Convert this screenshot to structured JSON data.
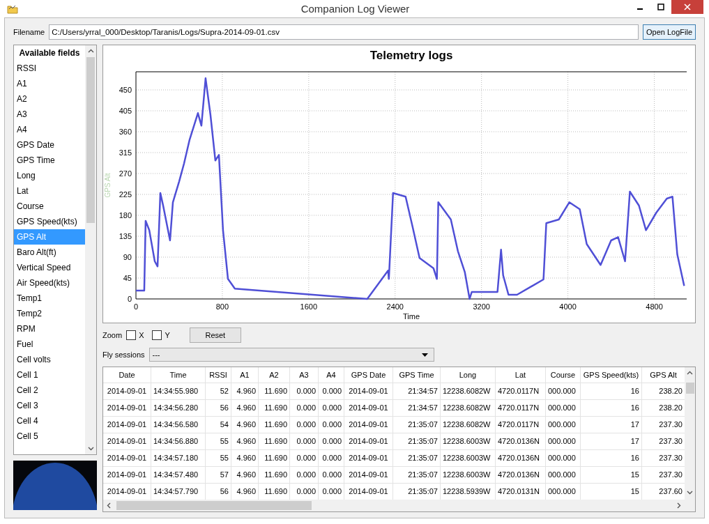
{
  "window": {
    "title": "Companion Log Viewer"
  },
  "file": {
    "label": "Filename",
    "value": "C:/Users/yrral_000/Desktop/Taranis/Logs/Supra-2014-09-01.csv",
    "button": "Open LogFile"
  },
  "fields": {
    "header": "Available fields",
    "items": [
      {
        "label": "RSSI",
        "selected": false
      },
      {
        "label": "A1",
        "selected": false
      },
      {
        "label": "A2",
        "selected": false
      },
      {
        "label": "A3",
        "selected": false
      },
      {
        "label": "A4",
        "selected": false
      },
      {
        "label": "GPS Date",
        "selected": false
      },
      {
        "label": "GPS Time",
        "selected": false
      },
      {
        "label": "Long",
        "selected": false
      },
      {
        "label": "Lat",
        "selected": false
      },
      {
        "label": "Course",
        "selected": false
      },
      {
        "label": "GPS Speed(kts)",
        "selected": false
      },
      {
        "label": "GPS Alt",
        "selected": true
      },
      {
        "label": "Baro Alt(ft)",
        "selected": false
      },
      {
        "label": "Vertical Speed",
        "selected": false
      },
      {
        "label": "Air Speed(kts)",
        "selected": false
      },
      {
        "label": "Temp1",
        "selected": false
      },
      {
        "label": "Temp2",
        "selected": false
      },
      {
        "label": "RPM",
        "selected": false
      },
      {
        "label": "Fuel",
        "selected": false
      },
      {
        "label": "Cell volts",
        "selected": false
      },
      {
        "label": "Cell 1",
        "selected": false
      },
      {
        "label": "Cell 2",
        "selected": false
      },
      {
        "label": "Cell 3",
        "selected": false
      },
      {
        "label": "Cell 4",
        "selected": false
      },
      {
        "label": "Cell 5",
        "selected": false
      }
    ]
  },
  "chart": {
    "chart_data": {
      "type": "line",
      "title": "Telemetry logs",
      "xlabel": "Time",
      "ylabel": "GPS Alt",
      "x": [
        0,
        77,
        90,
        123,
        174,
        200,
        213,
        226,
        252,
        316,
        342,
        400,
        445,
        497,
        574,
        606,
        645,
        690,
        735,
        768,
        806,
        852,
        916,
        2142,
        2335,
        2342,
        2381,
        2497,
        2561,
        2626,
        2755,
        2787,
        2800,
        2916,
        2981,
        3045,
        3090,
        3110,
        3348,
        3381,
        3400,
        3450,
        3529,
        3774,
        3800,
        3916,
        4013,
        4110,
        4174,
        4303,
        4400,
        4465,
        4529,
        4574,
        4658,
        4723,
        4819,
        4916,
        4968,
        5013,
        5077
      ],
      "series": [
        {
          "color": "#4f4fd6",
          "values": [
            18,
            18,
            168,
            148,
            81,
            70,
            148,
            228,
            201,
            126,
            208,
            253,
            291,
            343,
            400,
            373,
            475,
            396,
            298,
            310,
            148,
            43,
            22,
            0,
            61,
            43,
            228,
            220,
            156,
            88,
            66,
            43,
            208,
            171,
            103,
            58,
            0,
            15,
            15,
            106,
            51,
            9,
            9,
            42,
            163,
            171,
            208,
            193,
            118,
            73,
            126,
            133,
            81,
            231,
            201,
            148,
            186,
            216,
            220,
            96,
            28
          ]
        }
      ],
      "grid": true,
      "xlim": [
        0,
        5100
      ],
      "ylim": [
        0,
        489
      ],
      "xticks": [
        0,
        800,
        1600,
        2400,
        3200,
        4000,
        4800
      ],
      "yticks": [
        0,
        45,
        90,
        135,
        180,
        225,
        270,
        315,
        360,
        405,
        450
      ]
    }
  },
  "zoom": {
    "label": "Zoom",
    "options": [
      {
        "label": "X",
        "checked": false
      },
      {
        "label": "Y",
        "checked": false
      }
    ],
    "reset": "Reset"
  },
  "sessions": {
    "label": "Fly sessions",
    "value": "---"
  },
  "table": {
    "columns": [
      "Date",
      "Time",
      "RSSI",
      "A1",
      "A2",
      "A3",
      "A4",
      "GPS Date",
      "GPS Time",
      "Long",
      "Lat",
      "Course",
      "GPS Speed(kts)",
      "GPS Alt"
    ],
    "rows": [
      [
        "2014-09-01",
        "14:34:55.980",
        "52",
        "4.960",
        "11.690",
        "0.000",
        "0.000",
        "2014-09-01",
        "21:34:57",
        "12238.6082W",
        "4720.0117N",
        "000.000",
        "16",
        "238.20"
      ],
      [
        "2014-09-01",
        "14:34:56.280",
        "56",
        "4.960",
        "11.690",
        "0.000",
        "0.000",
        "2014-09-01",
        "21:34:57",
        "12238.6082W",
        "4720.0117N",
        "000.000",
        "16",
        "238.20"
      ],
      [
        "2014-09-01",
        "14:34:56.580",
        "54",
        "4.960",
        "11.690",
        "0.000",
        "0.000",
        "2014-09-01",
        "21:35:07",
        "12238.6082W",
        "4720.0117N",
        "000.000",
        "17",
        "237.30"
      ],
      [
        "2014-09-01",
        "14:34:56.880",
        "55",
        "4.960",
        "11.690",
        "0.000",
        "0.000",
        "2014-09-01",
        "21:35:07",
        "12238.6003W",
        "4720.0136N",
        "000.000",
        "17",
        "237.30"
      ],
      [
        "2014-09-01",
        "14:34:57.180",
        "55",
        "4.960",
        "11.690",
        "0.000",
        "0.000",
        "2014-09-01",
        "21:35:07",
        "12238.6003W",
        "4720.0136N",
        "000.000",
        "16",
        "237.30"
      ],
      [
        "2014-09-01",
        "14:34:57.480",
        "57",
        "4.960",
        "11.690",
        "0.000",
        "0.000",
        "2014-09-01",
        "21:35:07",
        "12238.6003W",
        "4720.0136N",
        "000.000",
        "15",
        "237.30"
      ],
      [
        "2014-09-01",
        "14:34:57.790",
        "56",
        "4.960",
        "11.690",
        "0.000",
        "0.000",
        "2014-09-01",
        "21:35:07",
        "12238.5939W",
        "4720.0131N",
        "000.000",
        "15",
        "237.60"
      ]
    ]
  }
}
